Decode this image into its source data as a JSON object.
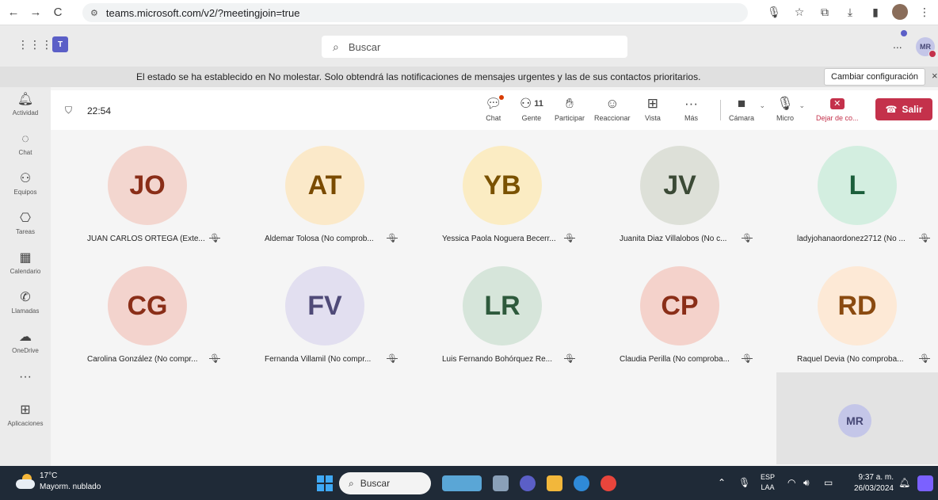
{
  "browser": {
    "back": "←",
    "forward": "→",
    "reload": "C",
    "url": "teams.microsoft.com/v2/?meetingjoin=true"
  },
  "teams": {
    "search_placeholder": "Buscar",
    "more": "...",
    "me_initials": "MR"
  },
  "banner": {
    "message": "El estado se ha establecido en No molestar. Solo obtendrá las notificaciones de mensajes urgentes y las de sus contactos prioritarios.",
    "button": "Cambiar configuración",
    "close": "×"
  },
  "rail": {
    "items": [
      "Actividad",
      "Chat",
      "Equipos",
      "Tareas",
      "Calendario",
      "Llamadas",
      "OneDrive",
      "Aplicaciones"
    ]
  },
  "meeting": {
    "timer": "22:54",
    "chat": "Chat",
    "people": "Gente",
    "people_count": "11",
    "raise": "Participar",
    "react": "Reaccionar",
    "view": "Vista",
    "more": "Más",
    "camera": "Cámara",
    "mic": "Micro",
    "stop_sharing": "Dejar de co...",
    "leave": "Salir"
  },
  "participants": [
    {
      "initials": "JO",
      "name": "JUAN CARLOS ORTEGA (Exte...",
      "bg": "#f3d6cf",
      "fg": "#8a2e18"
    },
    {
      "initials": "AT",
      "name": "Aldemar Tolosa (No comprob...",
      "bg": "#fbe9c9",
      "fg": "#7a4b00"
    },
    {
      "initials": "YB",
      "name": "Yessica Paola Noguera Becerr...",
      "bg": "#fbecc3",
      "fg": "#7a5200"
    },
    {
      "initials": "JV",
      "name": "Juanita Diaz Villalobos (No c...",
      "bg": "#dde0d8",
      "fg": "#3b4a36"
    },
    {
      "initials": "L",
      "name": "ladyjohanaordonez2712 (No ...",
      "bg": "#d3eee0",
      "fg": "#1b5e3b"
    },
    {
      "initials": "CG",
      "name": "Carolina González (No compr...",
      "bg": "#f3d3cd",
      "fg": "#8a2e18"
    },
    {
      "initials": "FV",
      "name": "Fernanda Villamil (No compr...",
      "bg": "#e2dff0",
      "fg": "#4f4a78"
    },
    {
      "initials": "LR",
      "name": "Luis Fernando Bohórquez Re...",
      "bg": "#d6e5da",
      "fg": "#2e5a3c"
    },
    {
      "initials": "CP",
      "name": "Claudia Perilla (No comproba...",
      "bg": "#f4d2cb",
      "fg": "#8a2e18"
    },
    {
      "initials": "RD",
      "name": "Raquel Devia (No comproba...",
      "bg": "#fde9d6",
      "fg": "#8a4a10"
    }
  ],
  "self": {
    "initials": "MR"
  },
  "taskbar": {
    "temperature": "17°C",
    "weather": "Mayorm. nublado",
    "search": "Buscar",
    "lang_1": "ESP",
    "lang_2": "LAA",
    "time": "9:37 a. m.",
    "date": "26/03/2024"
  }
}
